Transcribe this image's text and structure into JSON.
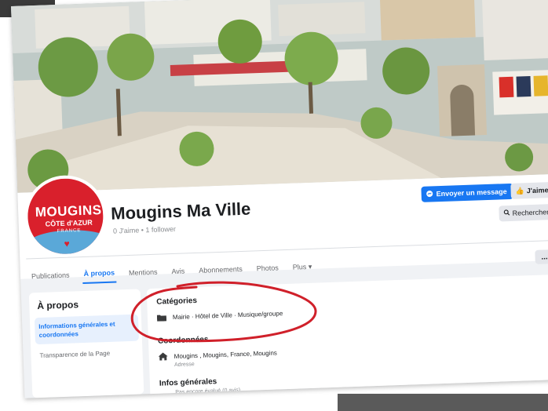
{
  "page": {
    "name": "Mougins Ma Ville",
    "stats": "0 J'aime • 1 follower"
  },
  "avatar": {
    "line1": "MOUGINS",
    "line2": "CÔTE d'AZUR",
    "line3": "FRANCE"
  },
  "actions": {
    "message": "Envoyer un message",
    "like": "J'aime",
    "search": "Rechercher",
    "more": "..."
  },
  "tabs": [
    {
      "label": "Publications"
    },
    {
      "label": "À propos"
    },
    {
      "label": "Mentions"
    },
    {
      "label": "Avis"
    },
    {
      "label": "Abonnements"
    },
    {
      "label": "Photos"
    },
    {
      "label": "Plus ▾"
    }
  ],
  "about": {
    "title": "À propos",
    "nav_active": "Informations générales et coordonnées",
    "nav_item": "Transparence de la Page",
    "categories_title": "Catégories",
    "categories_value": "Mairie · Hôtel de Ville · Musique/groupe",
    "contact_title": "Coordonnées",
    "address_value": "Mougins , Mougins, France, Mougins",
    "address_label": "Adresse",
    "general_title": "Infos générales",
    "general_value": "Pas encore évalué (0 avis)"
  },
  "colors": {
    "accent": "#1877f2",
    "annotation": "#d0202a",
    "logo": "#d9202c"
  },
  "icons": {
    "categories": "folder-icon",
    "address": "home-icon",
    "message": "messenger-icon",
    "like": "thumbs-up-icon",
    "search": "search-icon"
  }
}
